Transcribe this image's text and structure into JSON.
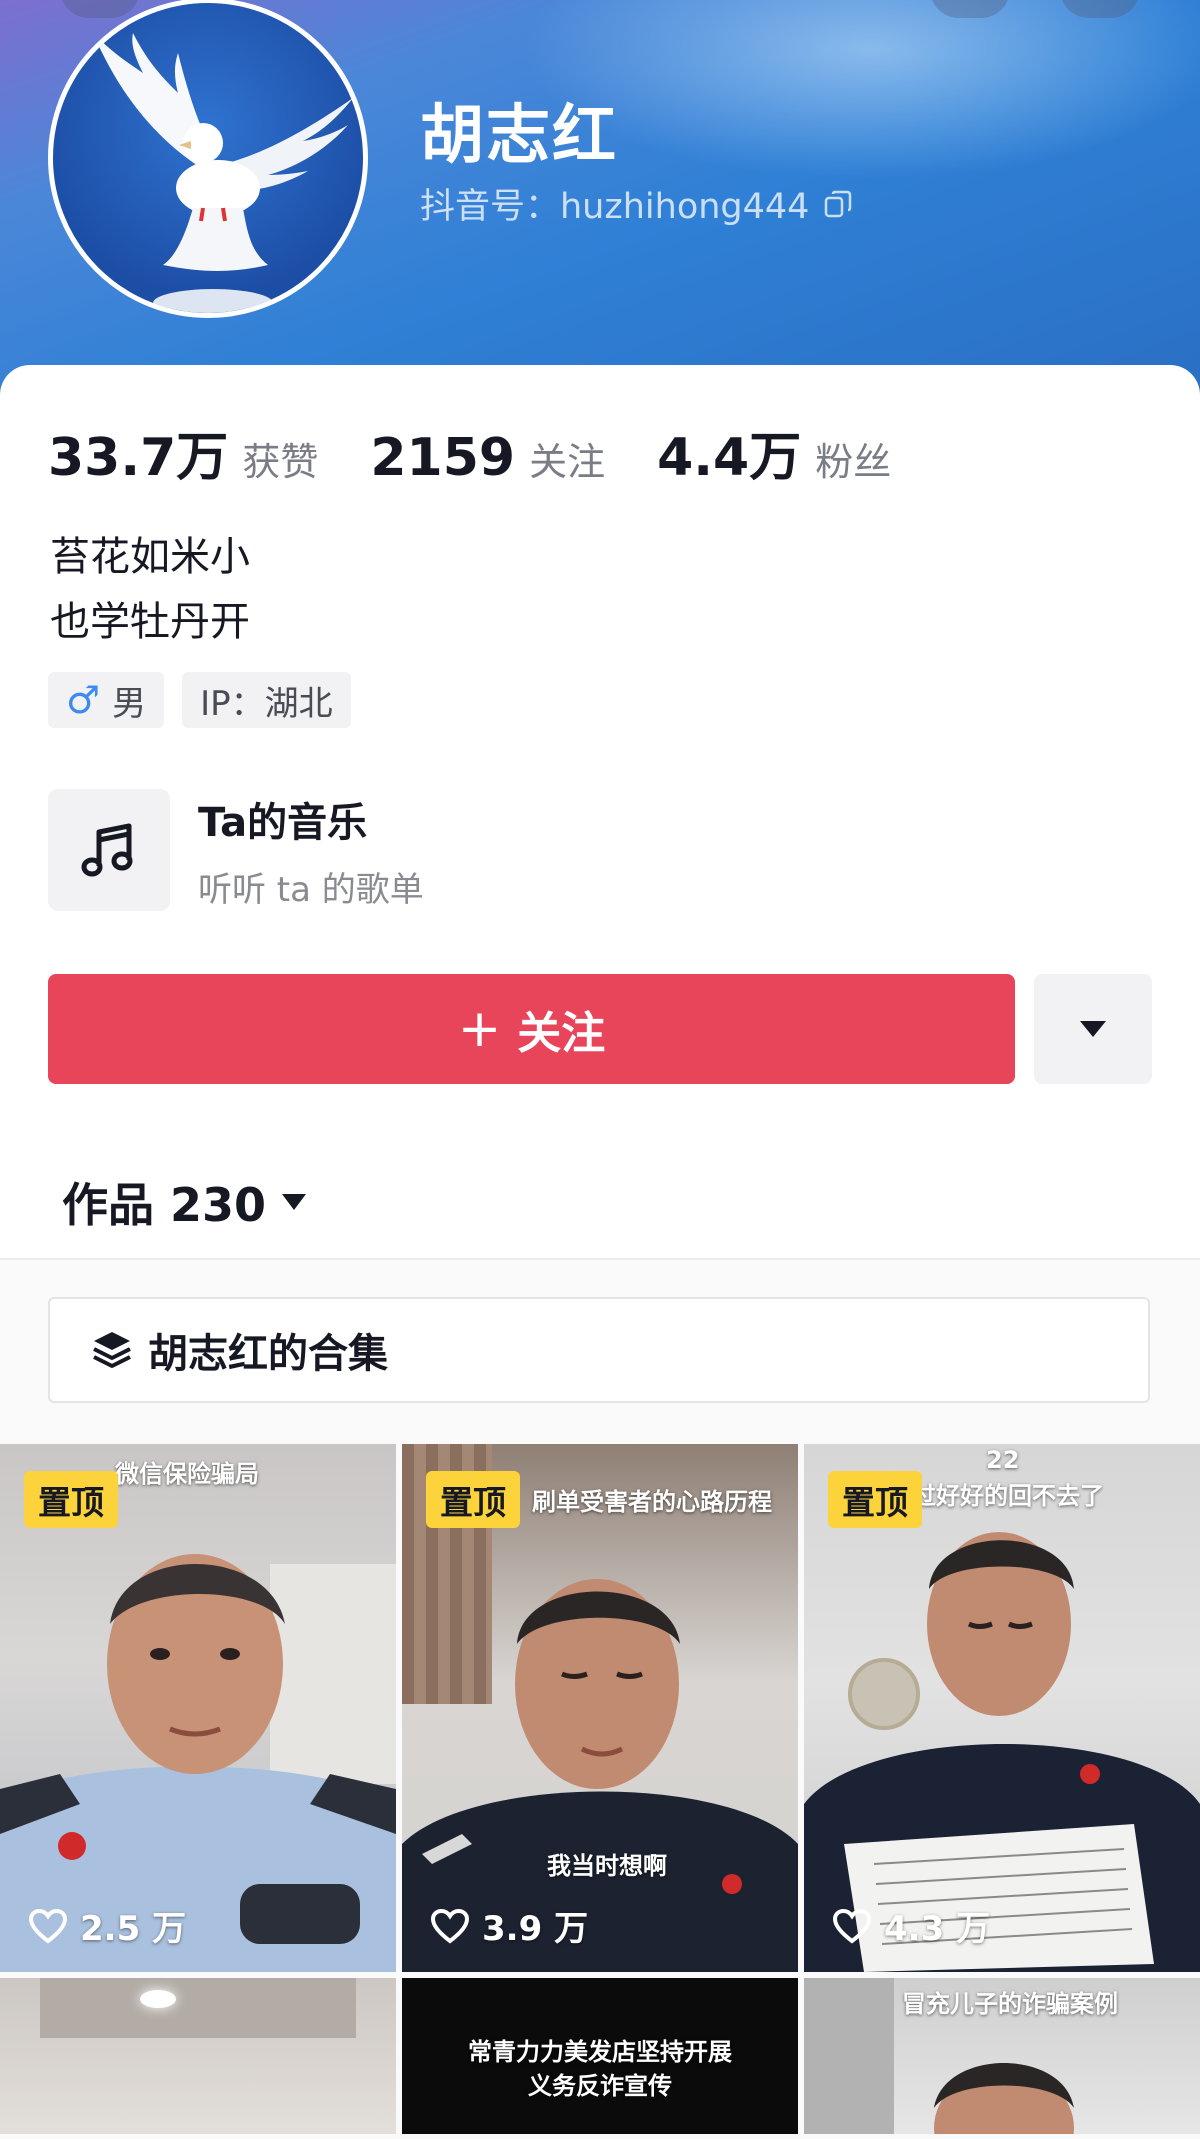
{
  "profile": {
    "name": "胡志红",
    "douyin_id": "抖音号：huzhihong444",
    "stats": [
      {
        "value": "33.7万",
        "label": "获赞"
      },
      {
        "value": "2159",
        "label": "关注"
      },
      {
        "value": "4.4万",
        "label": "粉丝"
      }
    ],
    "bio_lines": [
      "苔花如米小",
      "也学牡丹开"
    ],
    "tags": {
      "gender": "男",
      "ip": "IP：湖北"
    }
  },
  "music": {
    "title": "Ta的音乐",
    "subtitle": "听听 ta 的歌单"
  },
  "actions": {
    "follow_label": "关注",
    "follow_plus": "+"
  },
  "works": {
    "label": "作品 230"
  },
  "collection": {
    "label": "胡志红的合集"
  },
  "videos": [
    {
      "pinned": "置顶",
      "caption": "微信保险骗局",
      "sub": "",
      "likes": "2.5 万"
    },
    {
      "pinned": "置顶",
      "caption": "刷单受害者的心路历程",
      "sub": "我当时想啊",
      "likes": "3.9 万"
    },
    {
      "pinned": "置顶",
      "caption": "过好好的回不去了",
      "top_number": "22",
      "likes": "4.3 万"
    },
    {
      "pinned": "",
      "caption": "",
      "likes": ""
    },
    {
      "pinned": "",
      "caption_line1": "常青力力美发店坚持开展",
      "caption_line2": "义务反诈宣传",
      "likes": ""
    },
    {
      "pinned": "",
      "caption": "冒充儿子的诈骗案例",
      "likes": ""
    }
  ],
  "colors": {
    "accent": "#e8445a",
    "pin": "#fcd33b",
    "header": "#2f80d6"
  },
  "icons": [
    "copy-icon",
    "male-icon",
    "music-note-icon",
    "triangle-down-icon",
    "layers-icon",
    "heart-icon"
  ]
}
